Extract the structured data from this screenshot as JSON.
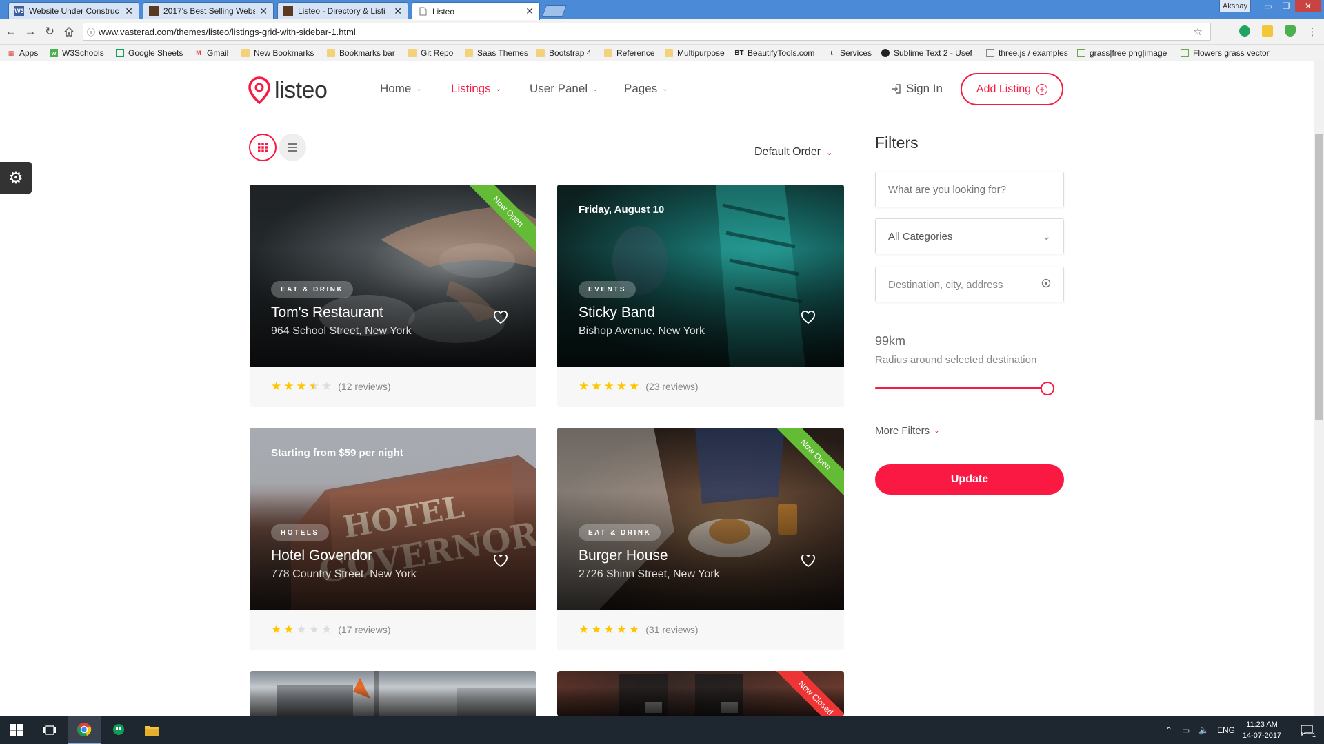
{
  "browser": {
    "tabs": [
      {
        "title": "Website Under Construc",
        "favicon": "W3"
      },
      {
        "title": "2017's Best Selling Webs",
        "favicon": ""
      },
      {
        "title": "Listeo - Directory & Listi",
        "favicon": ""
      },
      {
        "title": "Listeo",
        "favicon": ""
      }
    ],
    "user": "Akshay",
    "url": "www.vasterad.com/themes/listeo/listings-grid-with-sidebar-1.html",
    "bookmarks": [
      "Apps",
      "W3Schools",
      "Google Sheets",
      "Gmail",
      "New Bookmarks",
      "Bookmarks bar",
      "Git Repo",
      "Saas Themes",
      "Bootstrap 4",
      "Reference",
      "Multipurpose",
      "BeautifyTools.com",
      "Services",
      "Sublime Text 2 - Usef",
      "three.js / examples",
      "grass|free png|image",
      "Flowers grass vector"
    ]
  },
  "site": {
    "logo": "listeo",
    "nav": [
      {
        "label": "Home",
        "active": false
      },
      {
        "label": "Listings",
        "active": true
      },
      {
        "label": "User Panel",
        "active": false
      },
      {
        "label": "Pages",
        "active": false
      }
    ],
    "sign_in": "Sign In",
    "add_listing": "Add Listing",
    "accent": "#f91942"
  },
  "sort": {
    "label": "Default Order"
  },
  "listings": [
    {
      "category": "EAT & DRINK",
      "title": "Tom's Restaurant",
      "address": "964 School Street, New York",
      "rating": 3.5,
      "reviews": "(12 reviews)",
      "ribbon": "Now Open",
      "top_label": ""
    },
    {
      "category": "EVENTS",
      "title": "Sticky Band",
      "address": "Bishop Avenue, New York",
      "rating": 5,
      "reviews": "(23 reviews)",
      "ribbon": "",
      "top_label": "Friday, August 10"
    },
    {
      "category": "HOTELS",
      "title": "Hotel Govendor",
      "address": "778 Country Street, New York",
      "rating": 2,
      "reviews": "(17 reviews)",
      "ribbon": "",
      "top_label": "Starting from $59 per night"
    },
    {
      "category": "EAT & DRINK",
      "title": "Burger House",
      "address": "2726 Shinn Street, New York",
      "rating": 5,
      "reviews": "(31 reviews)",
      "ribbon": "Now Open",
      "top_label": ""
    },
    {
      "category": "",
      "title": "",
      "address": "",
      "rating": null,
      "reviews": "",
      "ribbon": "",
      "top_label": ""
    },
    {
      "category": "",
      "title": "",
      "address": "",
      "rating": null,
      "reviews": "",
      "ribbon": "Now Closed",
      "top_label": ""
    }
  ],
  "filters": {
    "title": "Filters",
    "keyword_placeholder": "What are you looking for?",
    "category_selected": "All Categories",
    "location_placeholder": "Destination, city, address",
    "radius_value": "99km",
    "radius_label": "Radius around selected destination",
    "radius_fraction": 1.0,
    "more_filters": "More Filters",
    "update": "Update"
  },
  "taskbar": {
    "language": "ENG",
    "time": "11:23 AM",
    "date": "14-07-2017",
    "notifications": "1"
  }
}
